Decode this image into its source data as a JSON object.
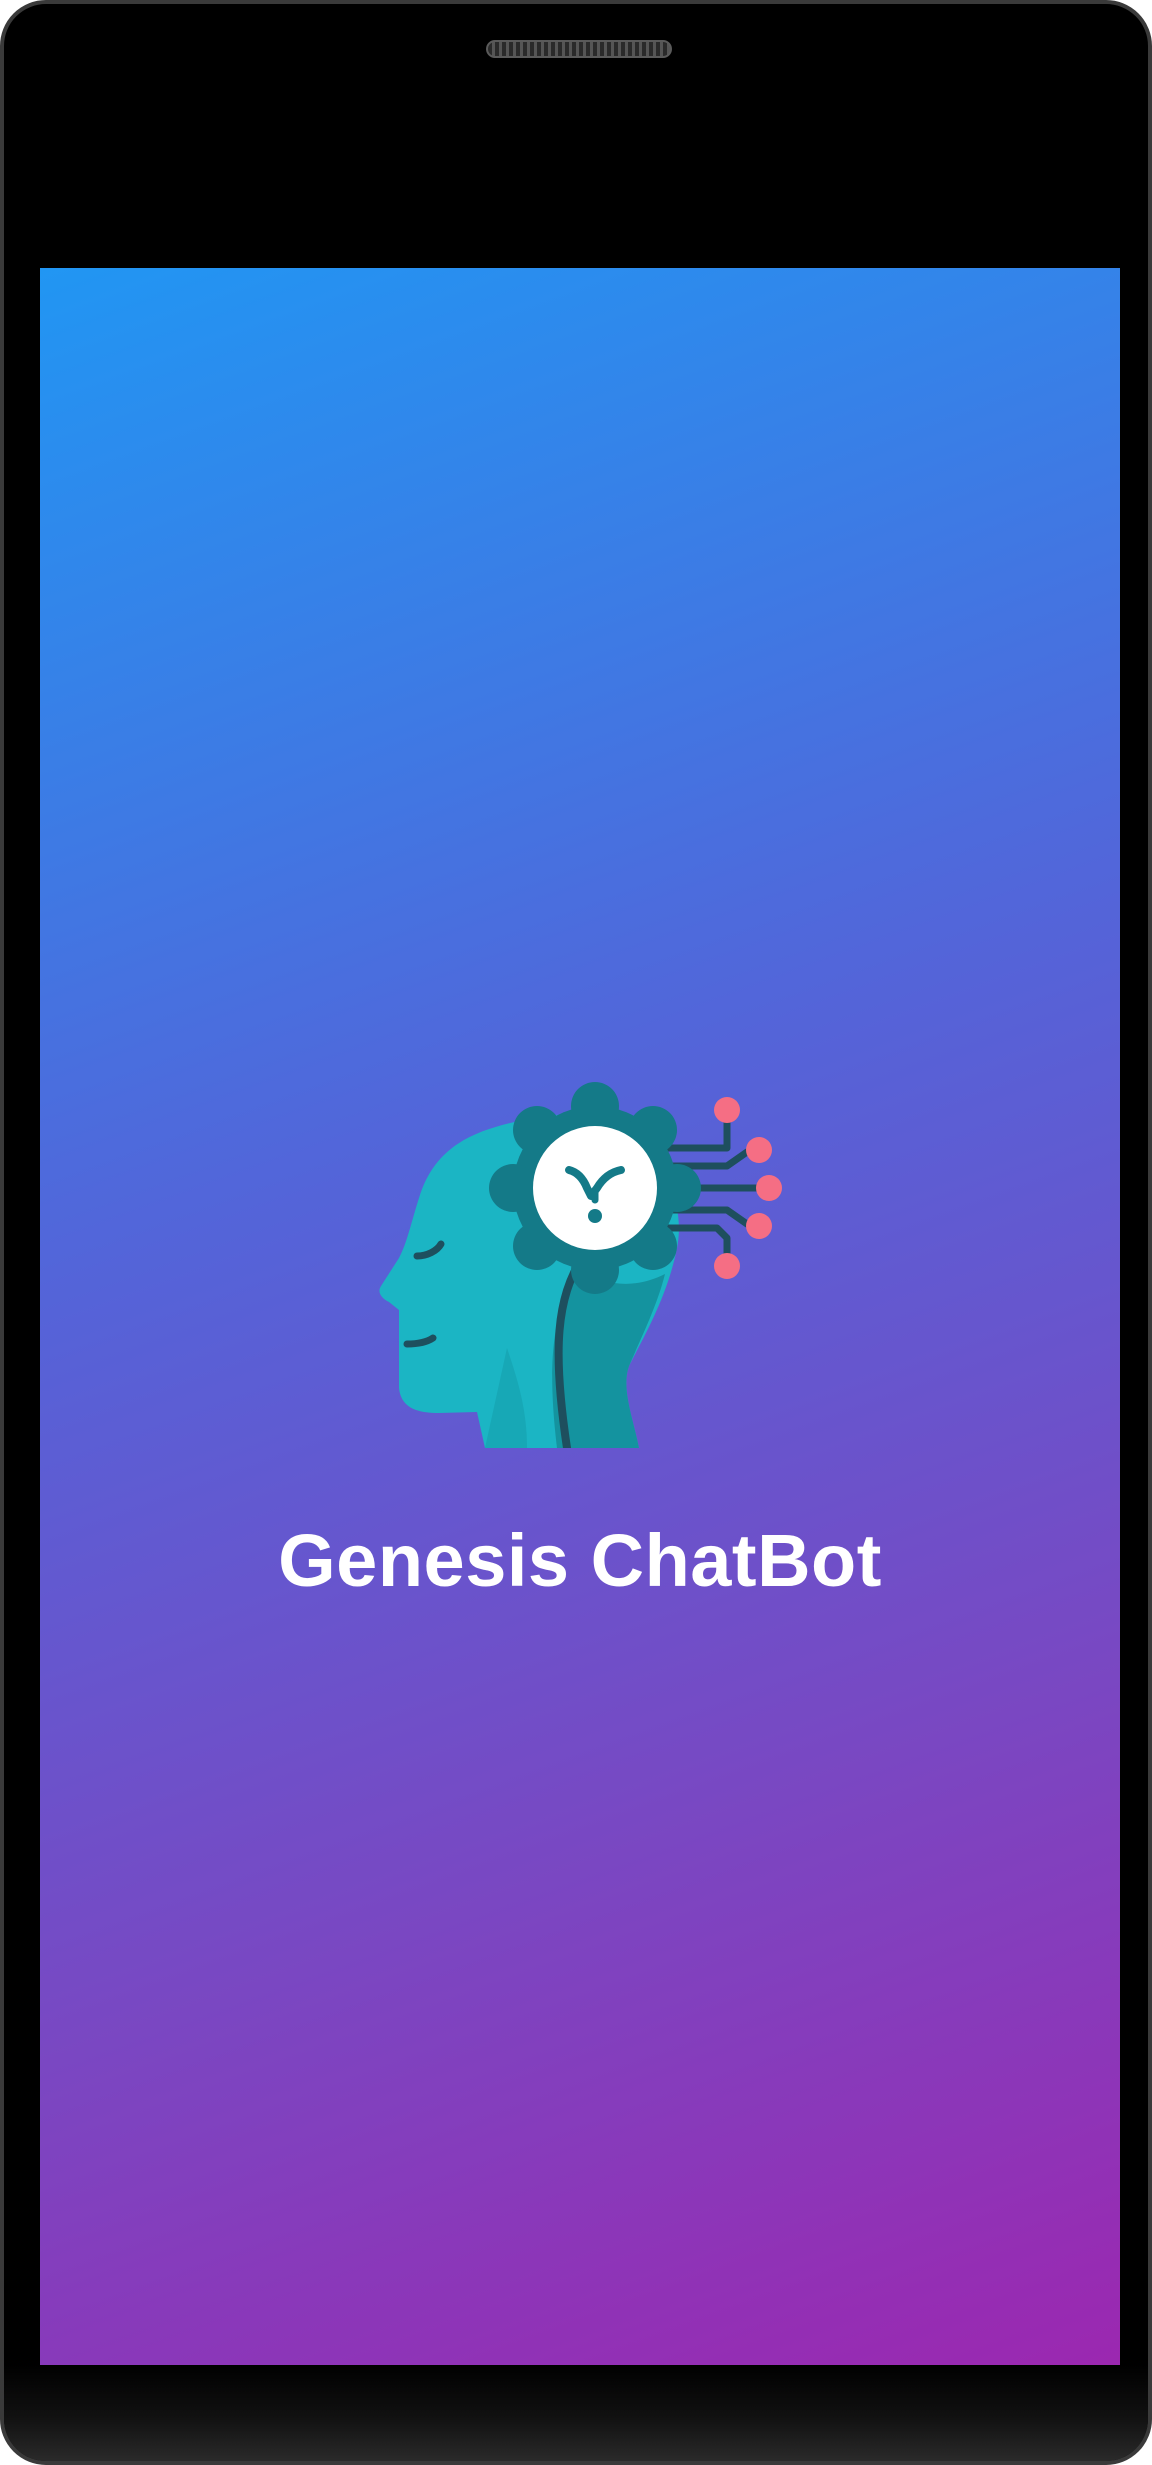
{
  "app": {
    "title": "Genesis ChatBot",
    "logo_icon": "ai-head-gear-circuit-icon"
  },
  "colors": {
    "gradient_start": "#2196F3",
    "gradient_end": "#9C27B0",
    "head_primary": "#1BB5C4",
    "head_shadow": "#14939F",
    "gear": "#147A88",
    "circuit_line": "#1E4F5E",
    "circuit_node": "#F56E84",
    "title_text": "#FFFFFF"
  }
}
